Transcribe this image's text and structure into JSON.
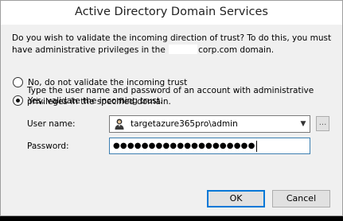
{
  "window": {
    "title": "Active Directory Domain Services"
  },
  "question": {
    "text_before": "Do you wish to validate the incoming direction of trust? To do this, you must have administrative privileges in the",
    "text_after": "corp.com domain."
  },
  "options": [
    {
      "label": "No, do not validate the incoming trust",
      "checked": false
    },
    {
      "label": "Yes, validate the incoming trust.",
      "checked": true
    }
  ],
  "instruction": "Type the user name and password of an account with administrative privileges in the specified domain.",
  "username": {
    "label": "User name:",
    "value": "targetazure365pro\\admin",
    "icon": "user-icon"
  },
  "browse_button": {
    "label": "..."
  },
  "password": {
    "label": "Password:",
    "masked_value": "●●●●●●●●●●●●●●●●●●●●"
  },
  "buttons": {
    "ok": "OK",
    "cancel": "Cancel"
  },
  "colors": {
    "focus_border": "#0078d7",
    "title_bg": "#ffffff",
    "dialog_bg": "#f0f0f0"
  }
}
